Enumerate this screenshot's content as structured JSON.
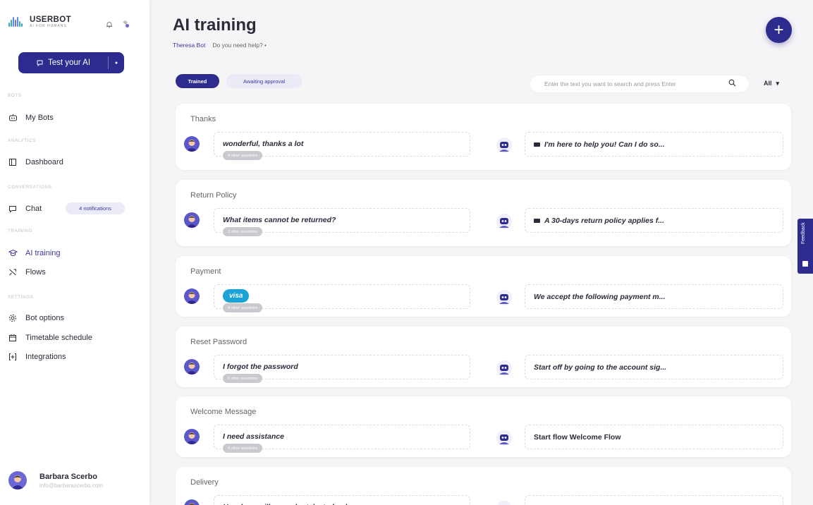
{
  "brand": {
    "name": "USERBOT",
    "tagline": "AI FOR HUMANS"
  },
  "sidebar": {
    "test_button": {
      "label": "Test your AI"
    },
    "sections": {
      "bots": "BOTS",
      "analytics": "ANALYTICS",
      "conversations": "CONVERSATIONS",
      "training": "TRAINING",
      "settings": "SETTINGS"
    },
    "items": {
      "my_bots": "My Bots",
      "dashboard": "Dashboard",
      "chat": "Chat",
      "chat_badge": "4 notifications",
      "ai_training": "AI training",
      "flows": "Flows",
      "bot_options": "Bot options",
      "timetable": "Timetable schedule",
      "integrations": "Integrations"
    },
    "user": {
      "name": "Barbara Scerbo",
      "email": "info@barbarascerbo.com"
    }
  },
  "header": {
    "title": "AI training",
    "bot_name": "Theresa Bot",
    "help": "Do you need help? •"
  },
  "tabs": {
    "trained": "Trained",
    "awaiting": "Awaiting approval"
  },
  "search": {
    "placeholder": "Enter the text you want to search and press Enter"
  },
  "filter": {
    "value": "All",
    "caret": "▾"
  },
  "cards": [
    {
      "title": "Thanks",
      "question": "wonderful, thanks a lot",
      "other": "4 other questions",
      "answer": "I'm here to help you! Can I do so..."
    },
    {
      "title": "Return Policy",
      "question": "What items cannot be returned?",
      "other": "3 other questions",
      "answer": "A 30-days return policy applies f..."
    },
    {
      "title": "Payment",
      "question": "visa",
      "other": "4 other questions",
      "answer": "We accept the following payment m..."
    },
    {
      "title": "Reset Password",
      "question": "I forgot the password",
      "other": "6 other questions",
      "answer": "Start off by going to the account sig..."
    },
    {
      "title": "Welcome Message",
      "question": "I need assistance",
      "other": "4 other questions",
      "answer": "Start flow Welcome Flow"
    },
    {
      "title": "Delivery",
      "question": "How long will my order take to be d...",
      "other": "",
      "answer": ""
    }
  ],
  "feedback": {
    "label": "Feedback"
  },
  "colors": {
    "primary": "#2d2b8e",
    "accent": "#3b39a0",
    "visa": "#1aa3d6"
  }
}
